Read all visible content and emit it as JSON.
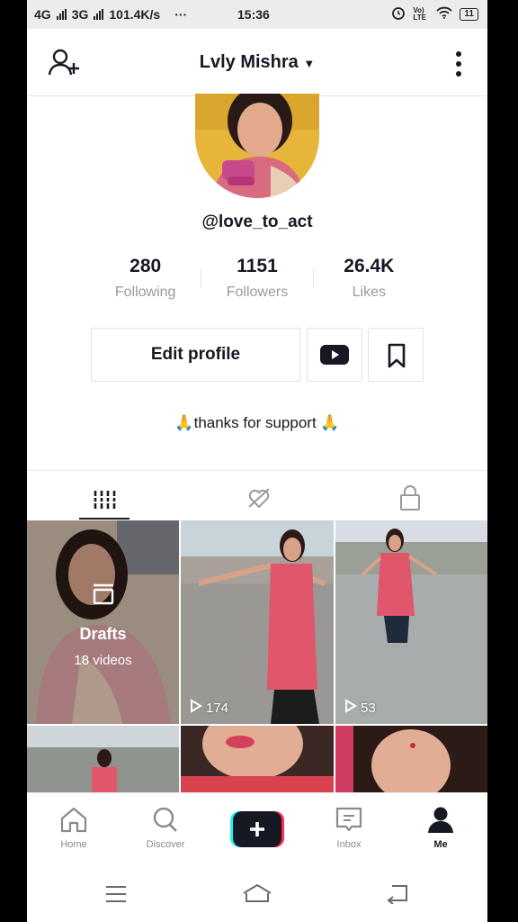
{
  "status_bar": {
    "net1": "4G",
    "net2": "3G",
    "speed": "101.4K/s",
    "dots": "···",
    "time": "15:36",
    "volte": "Vo) LTE",
    "battery": "11"
  },
  "header": {
    "title": "Lvly Mishra"
  },
  "profile": {
    "username": "@love_to_act",
    "bio": "thanks for support"
  },
  "stats": [
    {
      "num": "280",
      "label": "Following"
    },
    {
      "num": "1151",
      "label": "Followers"
    },
    {
      "num": "26.4K",
      "label": "Likes"
    }
  ],
  "buttons": {
    "edit": "Edit profile"
  },
  "videos": {
    "drafts_title": "Drafts",
    "drafts_count": "18 videos",
    "v1_views": "174",
    "v2_views": "53"
  },
  "tabbar": {
    "home": "Home",
    "discover": "Discover",
    "inbox": "Inbox",
    "me": "Me"
  },
  "colors": {
    "accent_red": "#fe2c55",
    "accent_cyan": "#25f4ee",
    "text": "#161823"
  }
}
